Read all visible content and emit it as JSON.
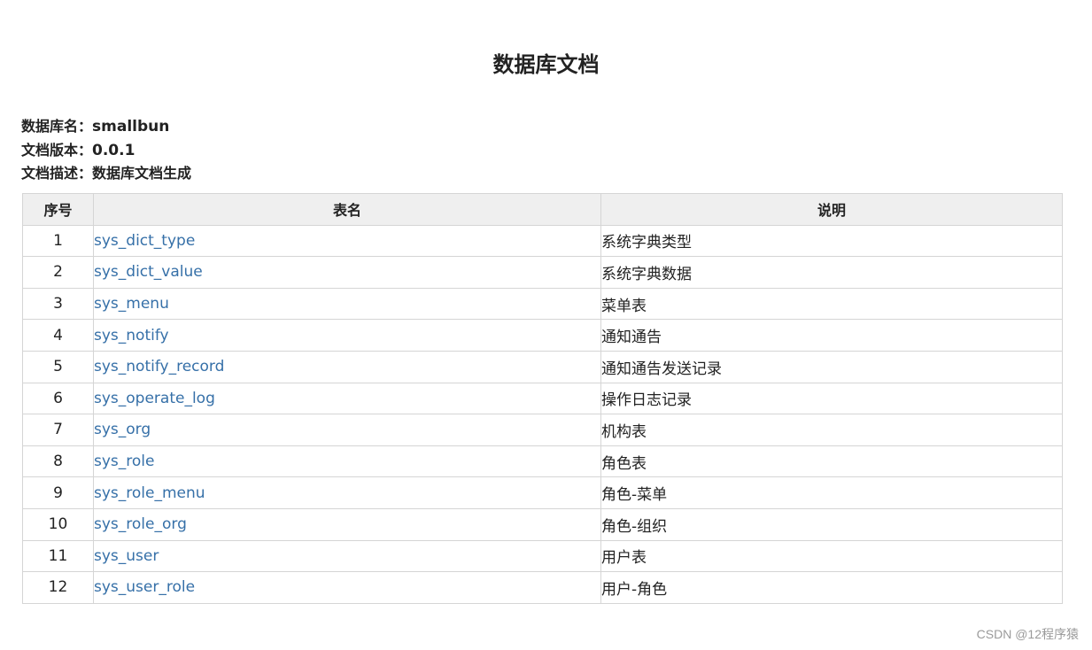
{
  "page": {
    "title": "数据库文档"
  },
  "meta": {
    "db_name_label": "数据库名：",
    "db_name_value": "smallbun",
    "version_label": "文档版本：",
    "version_value": "0.0.1",
    "desc_label": "文档描述：",
    "desc_value": "数据库文档生成"
  },
  "table": {
    "headers": {
      "no": "序号",
      "name": "表名",
      "desc": "说明"
    },
    "rows": [
      {
        "no": "1",
        "name": "sys_dict_type",
        "desc": "系统字典类型"
      },
      {
        "no": "2",
        "name": "sys_dict_value",
        "desc": "系统字典数据"
      },
      {
        "no": "3",
        "name": "sys_menu",
        "desc": "菜单表"
      },
      {
        "no": "4",
        "name": "sys_notify",
        "desc": "通知通告"
      },
      {
        "no": "5",
        "name": "sys_notify_record",
        "desc": "通知通告发送记录"
      },
      {
        "no": "6",
        "name": "sys_operate_log",
        "desc": "操作日志记录"
      },
      {
        "no": "7",
        "name": "sys_org",
        "desc": "机构表"
      },
      {
        "no": "8",
        "name": "sys_role",
        "desc": "角色表"
      },
      {
        "no": "9",
        "name": "sys_role_menu",
        "desc": "角色-菜单"
      },
      {
        "no": "10",
        "name": "sys_role_org",
        "desc": "角色-组织"
      },
      {
        "no": "11",
        "name": "sys_user",
        "desc": "用户表"
      },
      {
        "no": "12",
        "name": "sys_user_role",
        "desc": "用户-角色"
      }
    ]
  },
  "watermark": "CSDN @12程序猿",
  "colors": {
    "link": "#3670a8",
    "header_bg": "#efefef",
    "border": "#d5d5d5"
  }
}
